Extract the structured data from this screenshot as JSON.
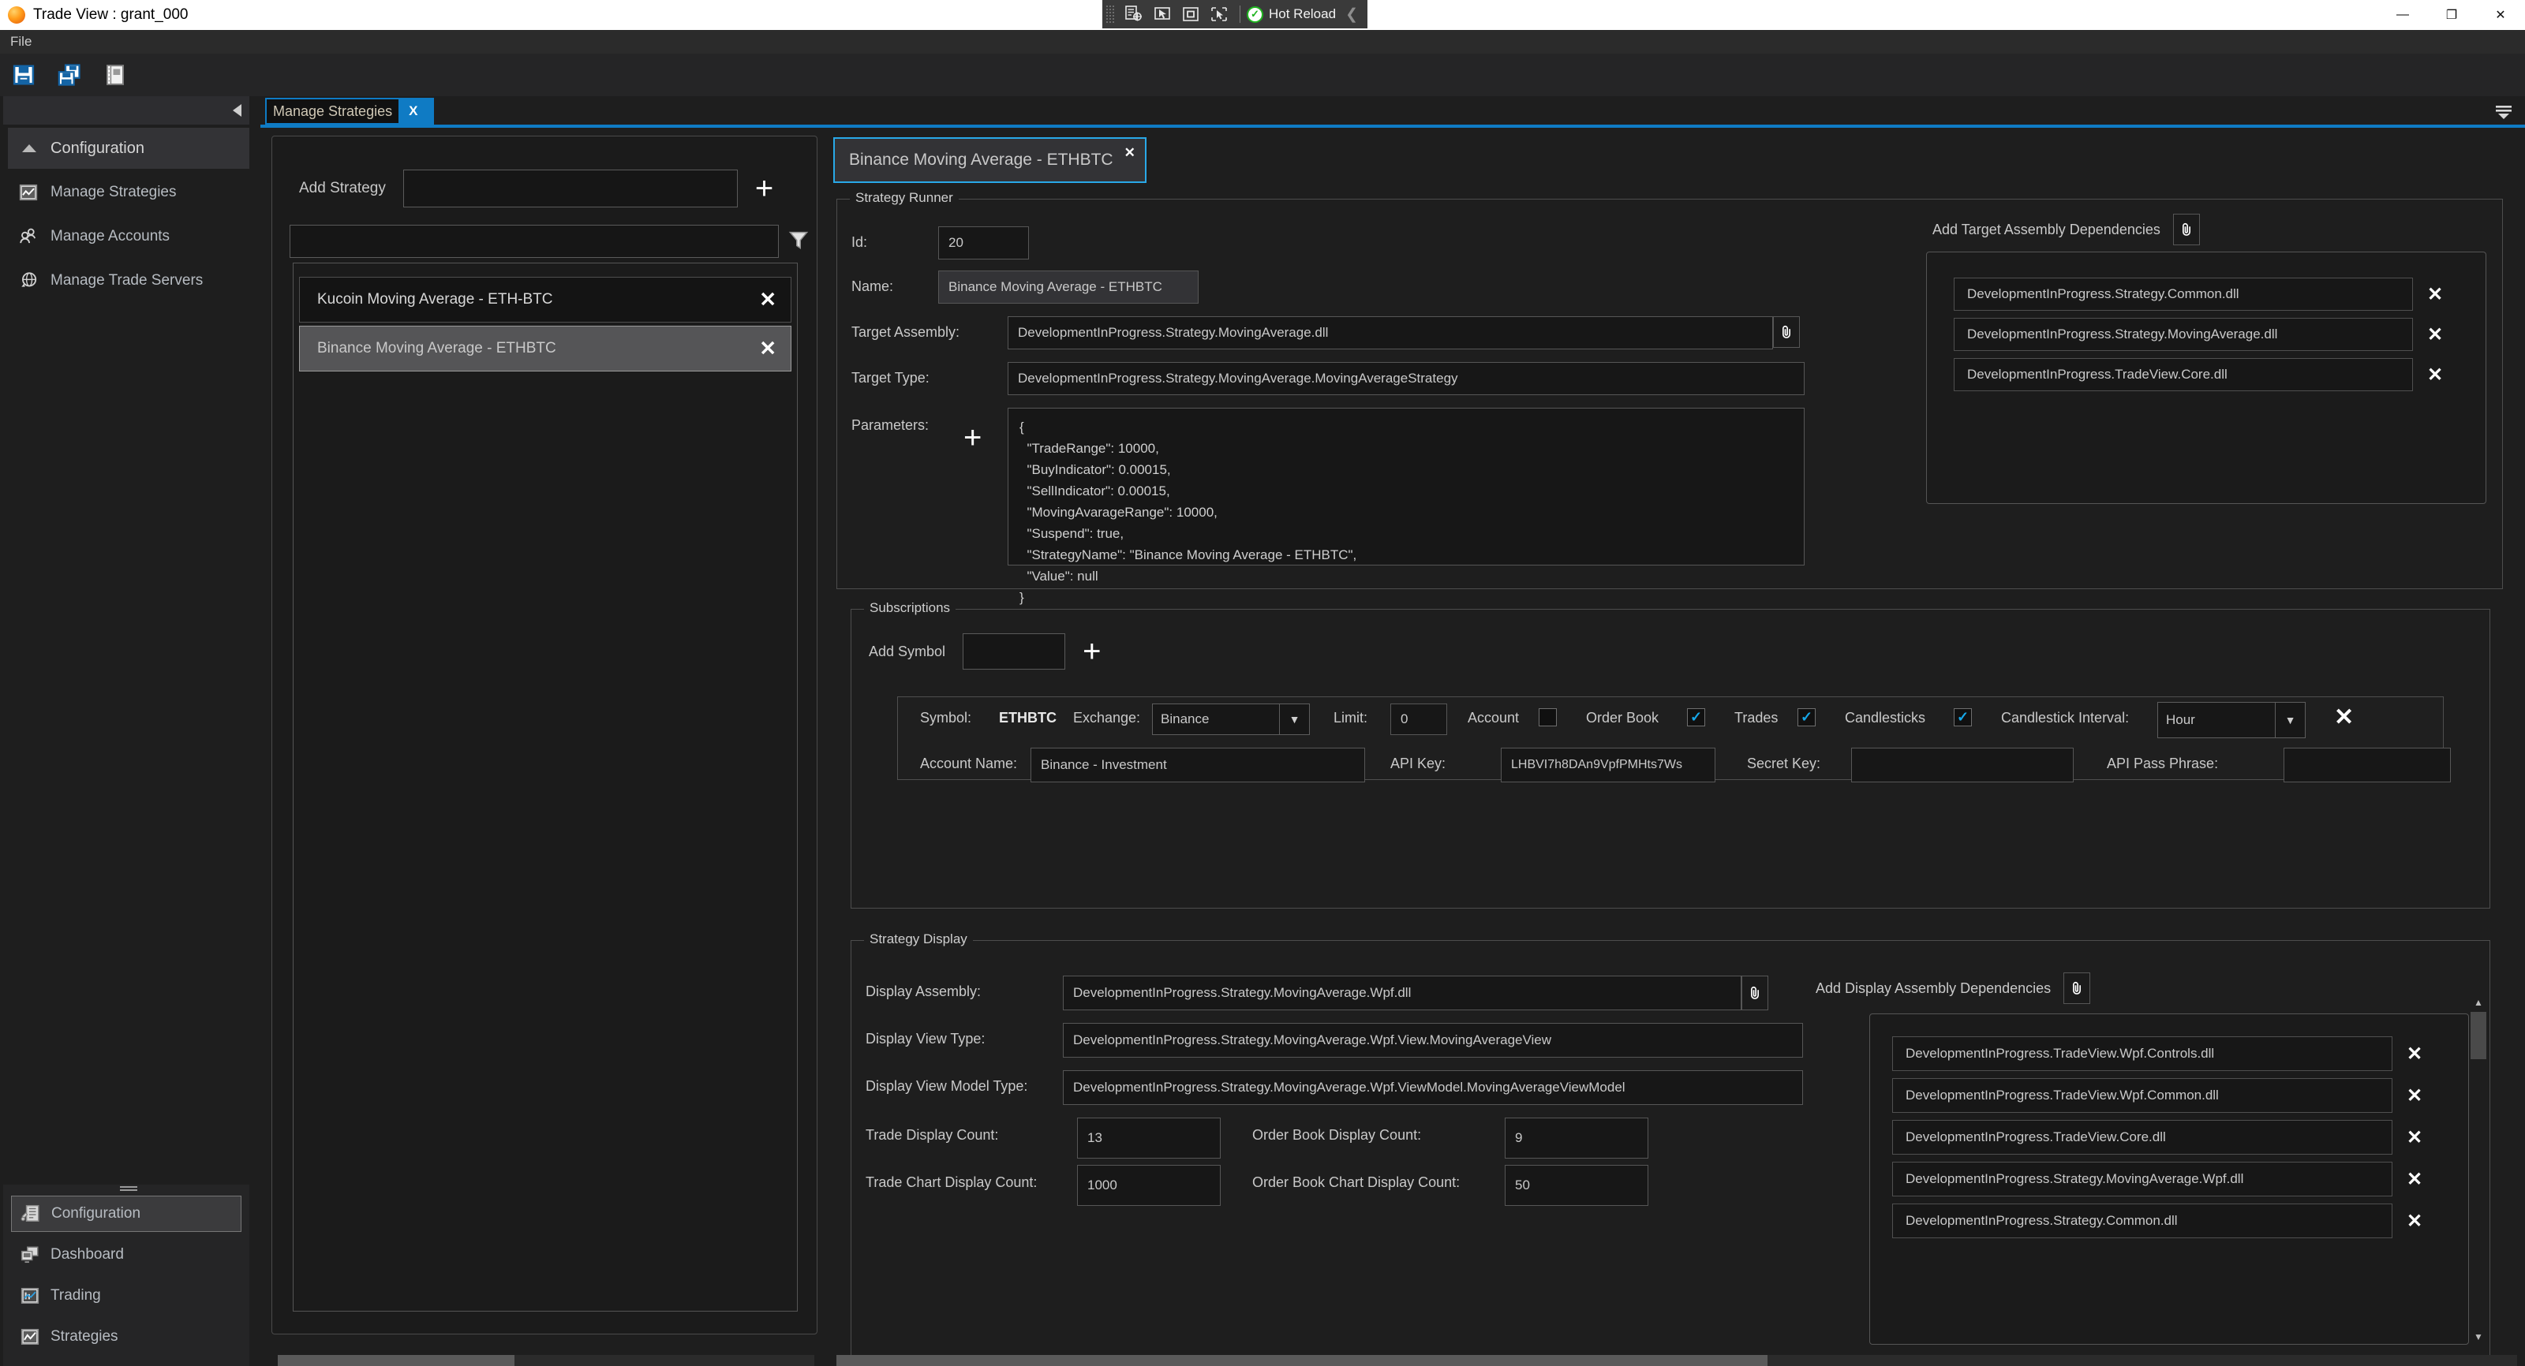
{
  "window": {
    "title": "Trade View : grant_000",
    "logo_icon": "app-orb-icon",
    "minimize_label": "—",
    "maximize_label": "❐",
    "close_label": "✕"
  },
  "hot_reload": {
    "label": "Hot Reload",
    "check_glyph": "✓",
    "chevron": "❮",
    "icons": [
      "live-property-explorer-icon",
      "select-element-icon",
      "display-layout-adorner-icon",
      "go-to-live-visual-tree-icon"
    ]
  },
  "menubar": {
    "items": [
      "File"
    ]
  },
  "toolbar": {
    "buttons": [
      {
        "name": "save-icon",
        "title": "Save"
      },
      {
        "name": "save-all-icon",
        "title": "Save All"
      },
      {
        "name": "notebook-icon",
        "title": "Notes"
      }
    ]
  },
  "sidebar": {
    "collapse_icon": "collapse-left-icon",
    "group": {
      "label": "Configuration",
      "expander_icon": "chevron-up-icon"
    },
    "items": [
      {
        "label": "Manage Strategies",
        "icon": "chart-square-icon"
      },
      {
        "label": "Manage Accounts",
        "icon": "people-icon"
      },
      {
        "label": "Manage Trade Servers",
        "icon": "server-globe-icon"
      }
    ],
    "bottom_items": [
      {
        "label": "Configuration",
        "icon": "configuration-icon",
        "selected": true
      },
      {
        "label": "Dashboard",
        "icon": "dashboard-icon",
        "selected": false
      },
      {
        "label": "Trading",
        "icon": "trading-chart-icon",
        "selected": false
      },
      {
        "label": "Strategies",
        "icon": "strategies-chart-icon",
        "selected": false
      }
    ]
  },
  "doc_tabs": [
    {
      "label": "Manage Strategies",
      "close_label": "X",
      "active": true
    }
  ],
  "tabstrip_overflow_icon": "tab-overflow-icon",
  "strategies_panel": {
    "add_strategy_label": "Add Strategy",
    "add_strategy_value": "",
    "add_strategy_placeholder": "",
    "add_button_glyph": "+",
    "filter_value": "",
    "filter_placeholder": "",
    "filter_icon": "funnel-filter-icon",
    "items": [
      {
        "name": "Kucoin Moving Average - ETH-BTC",
        "selected": false,
        "close_glyph": "✕"
      },
      {
        "name": "Binance Moving Average - ETHBTC",
        "selected": true,
        "close_glyph": "✕"
      }
    ]
  },
  "editor": {
    "inner_tab": {
      "label": "Binance Moving Average - ETHBTC",
      "close_label": "✕"
    },
    "strategy_runner": {
      "title": "Strategy Runner",
      "fields": {
        "id_label": "Id:",
        "id_value": "20",
        "name_label": "Name:",
        "name_value": "Binance Moving Average - ETHBTC",
        "target_assembly_label": "Target Assembly:",
        "target_assembly_value": "DevelopmentInProgress.Strategy.MovingAverage.dll",
        "target_type_label": "Target Type:",
        "target_type_value": "DevelopmentInProgress.Strategy.MovingAverage.MovingAverageStrategy",
        "parameters_label": "Parameters:",
        "parameters_add_glyph": "+",
        "parameters_value": "{\n  \"TradeRange\": 10000,\n  \"BuyIndicator\": 0.00015,\n  \"SellIndicator\": 0.00015,\n  \"MovingAvarageRange\": 10000,\n  \"Suspend\": true,\n  \"StrategyName\": \"Binance Moving Average - ETHBTC\",\n  \"Value\": null\n}",
        "attach_icon": "paperclip-icon"
      },
      "dependencies": {
        "add_label": "Add Target Assembly Dependencies",
        "add_icon": "paperclip-icon",
        "items": [
          {
            "name": "DevelopmentInProgress.Strategy.Common.dll",
            "close_glyph": "✕"
          },
          {
            "name": "DevelopmentInProgress.Strategy.MovingAverage.dll",
            "close_glyph": "✕"
          },
          {
            "name": "DevelopmentInProgress.TradeView.Core.dll",
            "close_glyph": "✕"
          }
        ]
      }
    },
    "subscriptions": {
      "title": "Subscriptions",
      "add_symbol_label": "Add Symbol",
      "add_symbol_value": "",
      "add_symbol_placeholder": "",
      "add_button_glyph": "+",
      "row": {
        "symbol_label": "Symbol:",
        "symbol_value": "ETHBTC",
        "exchange_label": "Exchange:",
        "exchange_value": "Binance",
        "limit_label": "Limit:",
        "limit_value": "0",
        "account_label": "Account",
        "account_checked": false,
        "order_book_label": "Order Book",
        "order_book_checked": true,
        "trades_label": "Trades",
        "trades_checked": true,
        "candlesticks_label": "Candlesticks",
        "candlesticks_checked": true,
        "candlestick_interval_label": "Candlestick Interval:",
        "candlestick_interval_value": "Hour",
        "remove_glyph": "✕",
        "account_name_label": "Account Name:",
        "account_name_value": "Binance - Investment",
        "api_key_label": "API Key:",
        "api_key_value": "LHBVI7h8DAn9VpfPMHts7Ws",
        "secret_key_label": "Secret Key:",
        "secret_key_value": "",
        "api_pass_phrase_label": "API Pass Phrase:",
        "api_pass_phrase_value": "",
        "dropdown_glyph": "▼"
      }
    },
    "strategy_display": {
      "title": "Strategy Display",
      "display_assembly_label": "Display Assembly:",
      "display_assembly_value": "DevelopmentInProgress.Strategy.MovingAverage.Wpf.dll",
      "display_view_type_label": "Display View Type:",
      "display_view_type_value": "DevelopmentInProgress.Strategy.MovingAverage.Wpf.View.MovingAverageView",
      "display_view_model_type_label": "Display View Model Type:",
      "display_view_model_type_value": "DevelopmentInProgress.Strategy.MovingAverage.Wpf.ViewModel.MovingAverageViewModel",
      "trade_display_count_label": "Trade Display Count:",
      "trade_display_count_value": "13",
      "order_book_display_count_label": "Order Book Display Count:",
      "order_book_display_count_value": "9",
      "trade_chart_display_count_label": "Trade Chart Display Count:",
      "trade_chart_display_count_value": "1000",
      "order_book_chart_display_count_label": "Order Book Chart Display Count:",
      "order_book_chart_display_count_value": "50",
      "attach_icon": "paperclip-icon",
      "dependencies": {
        "add_label": "Add Display Assembly Dependencies",
        "add_icon": "paperclip-icon",
        "items": [
          {
            "name": "DevelopmentInProgress.TradeView.Wpf.Controls.dll",
            "close_glyph": "✕"
          },
          {
            "name": "DevelopmentInProgress.TradeView.Wpf.Common.dll",
            "close_glyph": "✕"
          },
          {
            "name": "DevelopmentInProgress.TradeView.Core.dll",
            "close_glyph": "✕"
          },
          {
            "name": "DevelopmentInProgress.Strategy.MovingAverage.Wpf.dll",
            "close_glyph": "✕"
          },
          {
            "name": "DevelopmentInProgress.Strategy.Common.dll",
            "close_glyph": "✕"
          }
        ]
      },
      "scrollbar": {
        "up_glyph": "▲",
        "down_glyph": "▼"
      }
    }
  },
  "colors": {
    "accent": "#0f7bc4",
    "tab_border": "#29a9e8",
    "checkbox": "#16a7e8",
    "hot_reload_ok": "#1fb41f",
    "background": "#1e1e1e"
  }
}
